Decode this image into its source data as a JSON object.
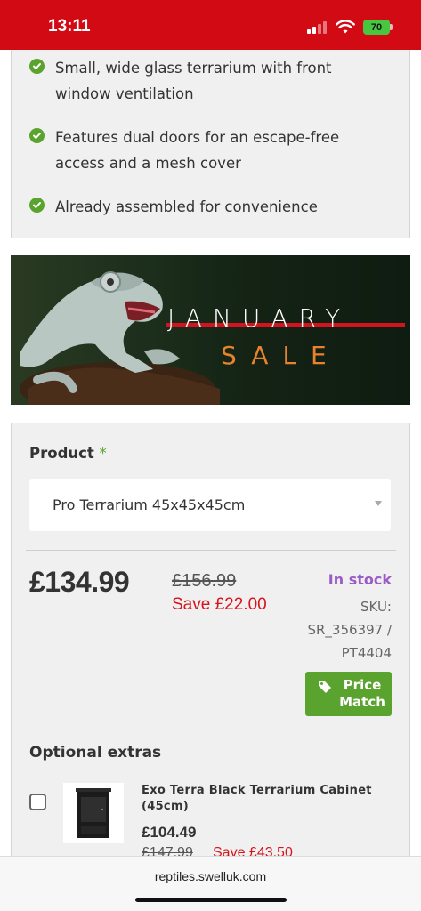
{
  "status_bar": {
    "time": "13:11",
    "battery": "70"
  },
  "features": [
    "Small, wide glass terrarium with front window ventilation",
    "Features dual doors for an escape-free access and a mesh cover",
    "Already assembled for convenience"
  ],
  "banner": {
    "title": "JANUARY",
    "subtitle": "SALE"
  },
  "product": {
    "label": "Product",
    "required_mark": "*",
    "selected": "Pro Terrarium 45x45x45cm",
    "price": "£134.99",
    "old_price": "£156.99",
    "save": "Save £22.00",
    "stock": "In stock",
    "sku": "SKU: SR_356397 / PT4404",
    "price_match": "Price Match"
  },
  "extras": {
    "label": "Optional extras",
    "items": [
      {
        "title": "Exo Terra Black Terrarium Cabinet (45cm)",
        "price": "£104.49",
        "old_price": "£147.99",
        "save": "Save £43.50"
      }
    ]
  },
  "url_bar": {
    "url": "reptiles.swelluk.com"
  },
  "colors": {
    "brand_red": "#d10a13",
    "accent_green": "#5aa32e",
    "stock_purple": "#9b5cc7",
    "sale_red": "#d7141e"
  }
}
